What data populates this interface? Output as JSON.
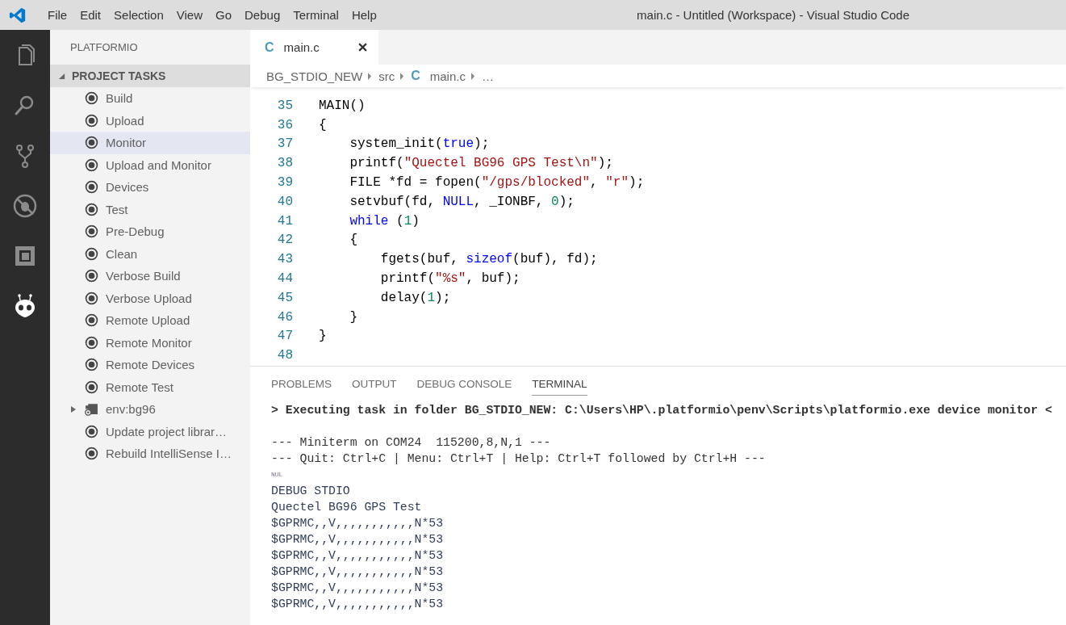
{
  "window": {
    "title": "main.c - Untitled (Workspace) - Visual Studio Code"
  },
  "menu": [
    "File",
    "Edit",
    "Selection",
    "View",
    "Go",
    "Debug",
    "Terminal",
    "Help"
  ],
  "activity_bar": [
    {
      "kind": "files",
      "selected": false
    },
    {
      "kind": "search",
      "selected": false
    },
    {
      "kind": "source-control",
      "selected": false
    },
    {
      "kind": "debug",
      "selected": false
    },
    {
      "kind": "extensions",
      "selected": false
    },
    {
      "kind": "platformio",
      "selected": true
    }
  ],
  "sidebar": {
    "title": "PLATFORMIO",
    "section": {
      "label": "PROJECT TASKS",
      "expanded": true,
      "items": [
        {
          "kind": "task",
          "label": "Build",
          "selected": false
        },
        {
          "kind": "task",
          "label": "Upload",
          "selected": false
        },
        {
          "kind": "task",
          "label": "Monitor",
          "selected": true
        },
        {
          "kind": "task",
          "label": "Upload and Monitor",
          "selected": false
        },
        {
          "kind": "task",
          "label": "Devices",
          "selected": false
        },
        {
          "kind": "task",
          "label": "Test",
          "selected": false
        },
        {
          "kind": "task",
          "label": "Pre-Debug",
          "selected": false
        },
        {
          "kind": "task",
          "label": "Clean",
          "selected": false
        },
        {
          "kind": "task",
          "label": "Verbose Build",
          "selected": false
        },
        {
          "kind": "task",
          "label": "Verbose Upload",
          "selected": false
        },
        {
          "kind": "task",
          "label": "Remote Upload",
          "selected": false
        },
        {
          "kind": "task",
          "label": "Remote Monitor",
          "selected": false
        },
        {
          "kind": "task",
          "label": "Remote Devices",
          "selected": false
        },
        {
          "kind": "task",
          "label": "Remote Test",
          "selected": false
        },
        {
          "kind": "env",
          "label": "env:bg96",
          "expanded": false,
          "selected": false
        },
        {
          "kind": "task",
          "label": "Update project librar…",
          "selected": false
        },
        {
          "kind": "task",
          "label": "Rebuild IntelliSense I…",
          "selected": false
        }
      ]
    }
  },
  "editor": {
    "tabs": [
      {
        "icon": "C",
        "label": "main.c",
        "selected": true
      }
    ],
    "breadcrumbs": [
      {
        "label": "BG_STDIO_NEW"
      },
      {
        "label": "src"
      },
      {
        "icon": "C",
        "label": "main.c"
      },
      {
        "label": "…"
      }
    ],
    "lines": [
      {
        "number": "35",
        "tokens": [
          {
            "kind": "plain",
            "text": "MAIN()"
          }
        ]
      },
      {
        "number": "36",
        "tokens": [
          {
            "kind": "plain",
            "text": "{"
          }
        ]
      },
      {
        "number": "37",
        "tokens": [
          {
            "kind": "plain",
            "text": "    system_init("
          },
          {
            "kind": "keyword",
            "text": "true"
          },
          {
            "kind": "plain",
            "text": ");"
          }
        ]
      },
      {
        "number": "38",
        "tokens": [
          {
            "kind": "plain",
            "text": "    printf("
          },
          {
            "kind": "string",
            "text": "\"Quectel BG96 GPS Test\\n\""
          },
          {
            "kind": "plain",
            "text": ");"
          }
        ]
      },
      {
        "number": "39",
        "tokens": [
          {
            "kind": "plain",
            "text": "    FILE *fd = fopen("
          },
          {
            "kind": "string",
            "text": "\"/gps/blocked\""
          },
          {
            "kind": "plain",
            "text": ", "
          },
          {
            "kind": "string",
            "text": "\"r\""
          },
          {
            "kind": "plain",
            "text": ");"
          }
        ]
      },
      {
        "number": "40",
        "tokens": [
          {
            "kind": "plain",
            "text": "    setvbuf(fd, "
          },
          {
            "kind": "keyword",
            "text": "NULL"
          },
          {
            "kind": "plain",
            "text": ", _IONBF, "
          },
          {
            "kind": "number",
            "text": "0"
          },
          {
            "kind": "plain",
            "text": ");"
          }
        ]
      },
      {
        "number": "41",
        "tokens": [
          {
            "kind": "keyword",
            "text": "    while"
          },
          {
            "kind": "plain",
            "text": " ("
          },
          {
            "kind": "number",
            "text": "1"
          },
          {
            "kind": "plain",
            "text": ")"
          }
        ]
      },
      {
        "number": "42",
        "tokens": [
          {
            "kind": "plain",
            "text": "    {"
          }
        ]
      },
      {
        "number": "43",
        "tokens": [
          {
            "kind": "plain",
            "text": "        fgets(buf, "
          },
          {
            "kind": "keyword",
            "text": "sizeof"
          },
          {
            "kind": "plain",
            "text": "(buf), fd);"
          }
        ]
      },
      {
        "number": "44",
        "tokens": [
          {
            "kind": "plain",
            "text": "        printf("
          },
          {
            "kind": "string",
            "text": "\"%s\""
          },
          {
            "kind": "plain",
            "text": ", buf);"
          }
        ]
      },
      {
        "number": "45",
        "tokens": [
          {
            "kind": "plain",
            "text": "        delay("
          },
          {
            "kind": "number",
            "text": "1"
          },
          {
            "kind": "plain",
            "text": ");"
          }
        ]
      },
      {
        "number": "46",
        "tokens": [
          {
            "kind": "plain",
            "text": "    }"
          }
        ]
      },
      {
        "number": "47",
        "tokens": [
          {
            "kind": "plain",
            "text": "}"
          }
        ]
      },
      {
        "number": "48"
      }
    ]
  },
  "panel": {
    "tabs": [
      {
        "label": "PROBLEMS",
        "selected": false
      },
      {
        "label": "OUTPUT",
        "selected": false
      },
      {
        "label": "DEBUG CONSOLE",
        "selected": false
      },
      {
        "label": "TERMINAL",
        "selected": true
      }
    ],
    "terminal": [
      {
        "kind": "command",
        "text": "> Executing task in folder BG_STDIO_NEW: C:\\Users\\HP\\.platformio\\penv\\Scripts\\platformio.exe device monitor <"
      },
      {
        "kind": "blank"
      },
      {
        "kind": "plain",
        "text": "--- Miniterm on COM24  115200,8,N,1 ---"
      },
      {
        "kind": "plain",
        "text": "--- Quit: Ctrl+C | Menu: Ctrl+T | Help: Ctrl+T followed by Ctrl+H ---"
      },
      {
        "kind": "control",
        "text": "NUL"
      },
      {
        "kind": "output",
        "text": "DEBUG STDIO"
      },
      {
        "kind": "output",
        "text": "Quectel BG96 GPS Test"
      },
      {
        "kind": "output",
        "text": "$GPRMC,,V,,,,,,,,,,,N*53"
      },
      {
        "kind": "output",
        "text": "$GPRMC,,V,,,,,,,,,,,N*53"
      },
      {
        "kind": "output",
        "text": "$GPRMC,,V,,,,,,,,,,,N*53"
      },
      {
        "kind": "output",
        "text": "$GPRMC,,V,,,,,,,,,,,N*53"
      },
      {
        "kind": "output",
        "text": "$GPRMC,,V,,,,,,,,,,,N*53"
      },
      {
        "kind": "output",
        "text": "$GPRMC,,V,,,,,,,,,,,N*53"
      }
    ]
  }
}
